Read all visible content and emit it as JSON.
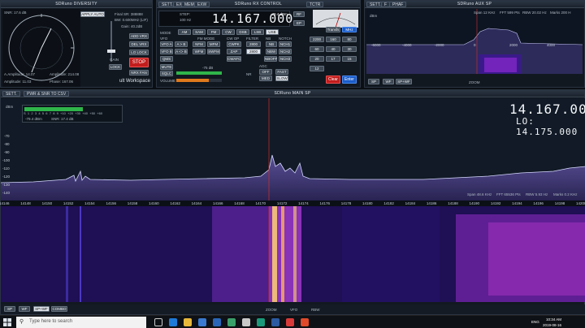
{
  "diversity": {
    "title": "SDRuno DIVERSITY",
    "snr": "SNR: 17.6 dB",
    "amplitude1": "A.Amplitude: 14.07",
    "amplitude2": "Amplitude: 11.03",
    "amplitude3": "Amplitude: 214.08",
    "phase": "Phase: 167.06",
    "apply_auto": "APPLY AUTO",
    "final_sr": "Final SR: 388888",
    "bw": "BW: 0.600MHz (LIF)",
    "gain": "Gain: 40.2dB",
    "add_vrx": "ADD VRX",
    "del_vrx": "DEL VRX",
    "lo_lock": "LO LOCK",
    "lock": "LOCK",
    "stop": "STOP",
    "nrx_fan": "NRX FAN",
    "workspace": "ult Workspace",
    "agc_label": "GAIN"
  },
  "rxcontrol": {
    "title": "SDRuno RX CONTROL",
    "tabs": [
      "SETT.",
      "EX",
      "MEMO",
      "EXW",
      "MEM",
      "TSTP",
      "VFO",
      "ZOOM",
      "TCTR"
    ],
    "freq": "14.167.000",
    "step_label": "STEP:",
    "step_val": "100 Hz",
    "dbm": "-79.4 dBm",
    "mode_label": "MODE",
    "modes": [
      "AM",
      "SAM",
      "FM",
      "CW",
      "DSB",
      "LSB",
      "USB",
      "DIGITAL"
    ],
    "vfo_label": "VFO",
    "fm_mode_label": "FM MODE",
    "cw_op_label": "CW OP",
    "filter_label": "FILTER",
    "nb_label": "NB",
    "notch_label": "NOTCH",
    "row1": [
      "VFO A",
      "A > B",
      "NFM",
      "MFM",
      "CWPK",
      "2800",
      "NB",
      "NCH1"
    ],
    "row2": [
      "VFO B",
      "A <> B",
      "WFM",
      "SWFM",
      "ZAP",
      "2800",
      "NBW",
      "NCH2"
    ],
    "row3": [
      "QMS",
      "",
      "",
      "",
      "",
      "",
      "NBOFF",
      "NCH3"
    ],
    "mute": "MUTE",
    "sqlc": "SQLC",
    "cwafc": "CWAFC",
    "squelch_val": "-75 dB",
    "agc_label": "AGC",
    "agc": [
      "OFF",
      "MED",
      "FAST",
      "SLOW"
    ],
    "volume_label": "VOLUME",
    "nr_label": "NR",
    "keys": [
      "1",
      "2",
      "3",
      "4",
      "5",
      "6",
      "7",
      "8",
      "9",
      "0"
    ],
    "key_labels": [
      "2200",
      "160",
      "80",
      "60",
      "40",
      "30",
      "20",
      "17",
      "15",
      "12"
    ],
    "split": "Transfs",
    "clear": "Clear",
    "enter": "Enter",
    "khz": "kHz",
    "mhz": "MHz",
    "ep_label": "EP",
    "rf_label": "RF"
  },
  "auxsp": {
    "title": "SDRuno AUX SP",
    "tabs": [
      "SETT.",
      "F",
      "PHAF"
    ],
    "span": "Span 12 KHz",
    "fft": "FFT 599 Pts",
    "rbw": "RBW 20.02 Hz",
    "marks": "Marks 200 H",
    "dbm": "dBm",
    "ticks": [
      "-6000",
      "-4000",
      "-2000",
      "0",
      "2000",
      "4000"
    ],
    "buttons": [
      "SP",
      "WF",
      "SP+WF"
    ],
    "zoom": "ZOOM"
  },
  "mainsp": {
    "title": "SDRuno MAIN SP",
    "sett": "SETT.",
    "pwr_csv": "PWR & SNR TO CSV",
    "dbm": "dBm",
    "meter_scale": [
      "S",
      "1",
      "2",
      "3",
      "4",
      "5",
      "6",
      "7",
      "8",
      "9",
      "+10",
      "+20",
      "+30",
      "+40",
      "+50",
      "+60"
    ],
    "meter_dbm": "-79.4 dBm",
    "meter_snr": "SNR: 17.4 dB",
    "freq": "14.167.000",
    "lo": "LO: 14.175.000",
    "y_ticks": [
      "-70",
      "-80",
      "-90",
      "-100",
      "-110",
      "-120",
      "-130",
      "-140"
    ],
    "x_ticks": [
      "14146",
      "14148",
      "14150",
      "14152",
      "14154",
      "14156",
      "14158",
      "14160",
      "14162",
      "14164",
      "14166",
      "14168",
      "14170",
      "14172",
      "14174",
      "14176",
      "14178",
      "14180",
      "14182",
      "14184",
      "14186",
      "14188",
      "14190",
      "14192",
      "14194",
      "14196",
      "14198",
      "14200"
    ],
    "span": "Span 48.6 KHz",
    "fft": "FFT 65536 Pts",
    "rbw": "RBW 5.93 Hz",
    "marks": "Marks 0.2 KHz",
    "bottom_buttons": [
      "SP",
      "WF",
      "SP+WF",
      "COMBO"
    ],
    "bottom_center": [
      "ZOOM",
      "VFO",
      "RBW"
    ]
  },
  "taskbar": {
    "search": "Type here to search",
    "time": "10:34 AM",
    "date": "2019-08-16",
    "lang": "ENG"
  },
  "colors": {
    "spectrum_fill": "#4a3e7a",
    "spectrum_line": "#c9c9ff",
    "waterfall_bg": "#1a0a4a",
    "signal_hot": "#ffe080",
    "accent_green": "#2fb54a"
  }
}
